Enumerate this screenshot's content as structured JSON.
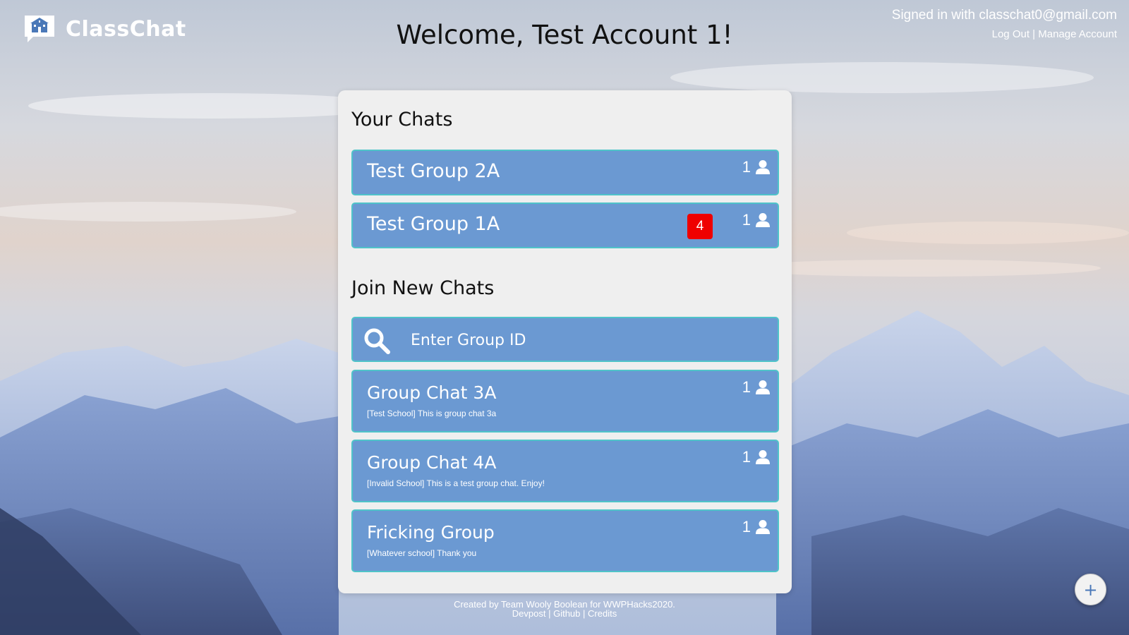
{
  "app": {
    "name": "ClassChat",
    "logo_icon": "school-chat-icon"
  },
  "header": {
    "welcome": "Welcome, Test Account 1!",
    "signed_in": "Signed in with classchat0@gmail.com",
    "logout": "Log Out",
    "separator": "|",
    "manage": "Manage Account"
  },
  "your_chats": {
    "title": "Your Chats",
    "items": [
      {
        "name": "Test Group 2A",
        "members": "1",
        "unread": ""
      },
      {
        "name": "Test Group 1A",
        "members": "1",
        "unread": "4"
      }
    ]
  },
  "join_chats": {
    "title": "Join New Chats",
    "search_placeholder": "Enter Group ID",
    "items": [
      {
        "name": "Group Chat 3A",
        "description": "[Test School] This is group chat 3a",
        "members": "1"
      },
      {
        "name": "Group Chat 4A",
        "description": "[Invalid School] This is a test group chat. Enjoy!",
        "members": "1"
      },
      {
        "name": "Fricking Group",
        "description": "[Whatever school] Thank you",
        "members": "1"
      }
    ]
  },
  "footer": {
    "credit_line": "Created by Team Wooly Boolean for WWPHacks2020.",
    "devpost": "Devpost",
    "github": "Github",
    "credits": "Credits",
    "separator": "|"
  },
  "fab": {
    "label": "+"
  },
  "colors": {
    "item_bg": "#6b99d2",
    "item_border": "#4fc3c9",
    "badge_bg": "#ef0000",
    "card_bg": "#efefef"
  }
}
